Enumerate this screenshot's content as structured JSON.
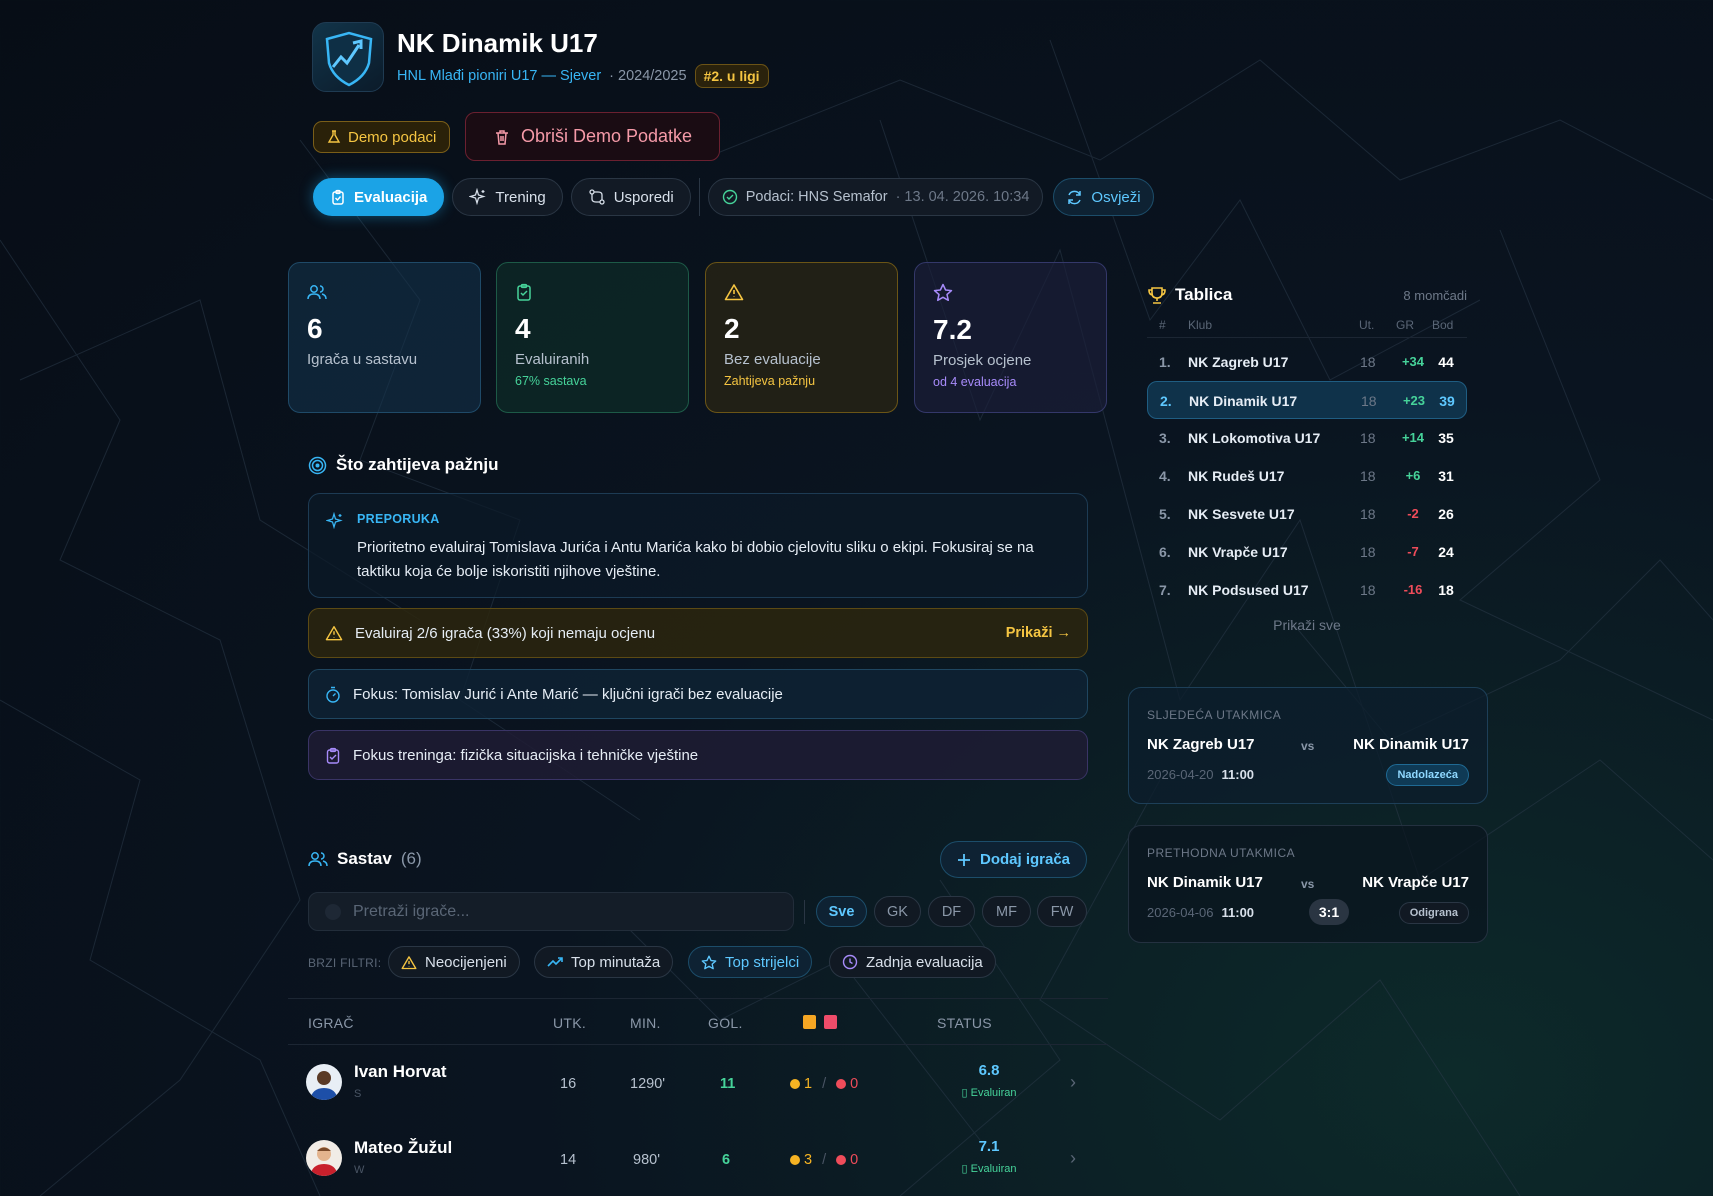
{
  "header": {
    "team_name": "NK Dinamik U17",
    "league": "HNL Mlađi pioniri U17 — Sjever",
    "season": "· 2024/2025",
    "rank_badge": "#2. u ligi"
  },
  "demo": {
    "badge_label": "Demo podaci",
    "delete_label": "Obriši Demo Podatke"
  },
  "nav": {
    "tabs": [
      {
        "label": "Evaluacija",
        "active": true
      },
      {
        "label": "Trening",
        "active": false
      },
      {
        "label": "Usporedi",
        "active": false
      }
    ],
    "sync_label": "Podaci: HNS Semafor",
    "sync_time": "· 13. 04. 2026. 10:34",
    "refresh_label": "Osvježi"
  },
  "stats": [
    {
      "value": "6",
      "label": "Igrača u sastavu",
      "sub": ""
    },
    {
      "value": "4",
      "label": "Evaluiranih",
      "sub": "67% sastava"
    },
    {
      "value": "2",
      "label": "Bez evaluacije",
      "sub": "Zahtijeva pažnju"
    },
    {
      "value": "7.2",
      "label": "Prosjek ocjene",
      "sub": "od 4 evaluacija"
    }
  ],
  "attention": {
    "title": "Što zahtijeva pažnju",
    "recommendation_kicker": "PREPORUKA",
    "recommendation_text": "Prioritetno evaluiraj Tomislava Jurića i Antu Marića kako bi dobio cjelovitu sliku o ekipi. Fokusiraj se na taktiku koja će bolje iskoristiti njihove vještine.",
    "alert_missing": "Evaluiraj 2/6 igrača (33%) koji nemaju ocjenu",
    "alert_missing_link": "Prikaži →",
    "alert_focus": "Fokus: Tomislav Jurić i Ante Marić — ključni igrači bez evaluacije",
    "alert_training": "Fokus treninga: fizička situacijska i tehničke vještine"
  },
  "roster": {
    "title": "Sastav",
    "count": "(6)",
    "add_label": "Dodaj igrača",
    "search_placeholder": "Pretraži igrače...",
    "positions": [
      {
        "label": "Sve",
        "active": true
      },
      {
        "label": "GK",
        "active": false
      },
      {
        "label": "DF",
        "active": false
      },
      {
        "label": "MF",
        "active": false
      },
      {
        "label": "FW",
        "active": false
      }
    ],
    "quick_filters_label": "BRZI FILTRI:",
    "quick_filters": [
      {
        "label": "Neocijenjeni",
        "icon": "warning-icon",
        "active": false
      },
      {
        "label": "Top minutaža",
        "icon": "trend-up-icon",
        "active": false
      },
      {
        "label": "Top strijelci",
        "icon": "star-icon",
        "active": true
      },
      {
        "label": "Zadnja evaluacija",
        "icon": "clock-icon",
        "active": false
      }
    ],
    "columns": {
      "player": "IGRAČ",
      "apps": "UTK.",
      "minutes": "MIN.",
      "goals": "GOL.",
      "status": "STATUS"
    },
    "players": [
      {
        "name": "Ivan Horvat",
        "position": "S",
        "apps": "16",
        "minutes": "1290'",
        "goals": "11",
        "yellow": "1",
        "red": "0",
        "rating": "6.8",
        "status": "Evaluiran"
      },
      {
        "name": "Mateo Žužul",
        "position": "W",
        "apps": "14",
        "minutes": "980'",
        "goals": "6",
        "yellow": "3",
        "red": "0",
        "rating": "7.1",
        "status": "Evaluiran"
      }
    ]
  },
  "standings": {
    "title": "Tablica",
    "team_count": "8 momčadi",
    "cols": {
      "pos": "#",
      "club": "Klub",
      "played": "Ut.",
      "gd": "GR",
      "points": "Bod"
    },
    "rows": [
      {
        "pos": "1.",
        "club": "NK Zagreb U17",
        "played": "18",
        "gd": "+34",
        "points": "44",
        "highlight": false
      },
      {
        "pos": "2.",
        "club": "NK Dinamik U17",
        "played": "18",
        "gd": "+23",
        "points": "39",
        "highlight": true
      },
      {
        "pos": "3.",
        "club": "NK Lokomotiva U17",
        "played": "18",
        "gd": "+14",
        "points": "35",
        "highlight": false
      },
      {
        "pos": "4.",
        "club": "NK Rudeš U17",
        "played": "18",
        "gd": "+6",
        "points": "31",
        "highlight": false
      },
      {
        "pos": "5.",
        "club": "NK Sesvete U17",
        "played": "18",
        "gd": "-2",
        "points": "26",
        "highlight": false
      },
      {
        "pos": "6.",
        "club": "NK Vrapče U17",
        "played": "18",
        "gd": "-7",
        "points": "24",
        "highlight": false
      },
      {
        "pos": "7.",
        "club": "NK Podsused U17",
        "played": "18",
        "gd": "-16",
        "points": "18",
        "highlight": false
      }
    ],
    "show_all": "Prikaži sve"
  },
  "next_match": {
    "kicker": "SLJEDEĆA UTAKMICA",
    "home": "NK Zagreb U17",
    "vs": "vs",
    "away": "NK Dinamik U17",
    "date": "2026-04-20",
    "time": "11:00",
    "badge": "Nadolazeća"
  },
  "prev_match": {
    "kicker": "PRETHODNA UTAKMICA",
    "home": "NK Dinamik U17",
    "vs": "vs",
    "away": "NK Vrapče U17",
    "date": "2026-04-06",
    "time": "11:00",
    "score": "3:1",
    "badge": "Odigrana"
  },
  "colors": {
    "accent": "#1ba3e6",
    "accent_light": "#5ec8ff",
    "amber": "#f5c542",
    "green": "#46d39a",
    "red": "#ef4c5a",
    "violet": "#a78bfa"
  }
}
